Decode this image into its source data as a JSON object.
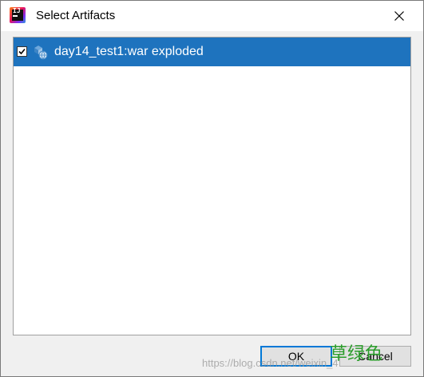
{
  "window": {
    "title": "Select Artifacts",
    "app_icon": "intellij-idea-icon",
    "close_icon": "close-icon"
  },
  "artifacts": {
    "items": [
      {
        "label": "day14_test1:war exploded",
        "checked": true,
        "selected": true,
        "icon": "web-artifact-icon"
      }
    ]
  },
  "buttons": {
    "ok": "OK",
    "cancel": "Cancel"
  },
  "watermark": {
    "url": "https://blog.csdn.net/weixin_4",
    "text": "草绿色"
  },
  "colors": {
    "selection": "#1e73be",
    "focus_border": "#0078d7",
    "watermark_text": "#2a9d2a"
  }
}
